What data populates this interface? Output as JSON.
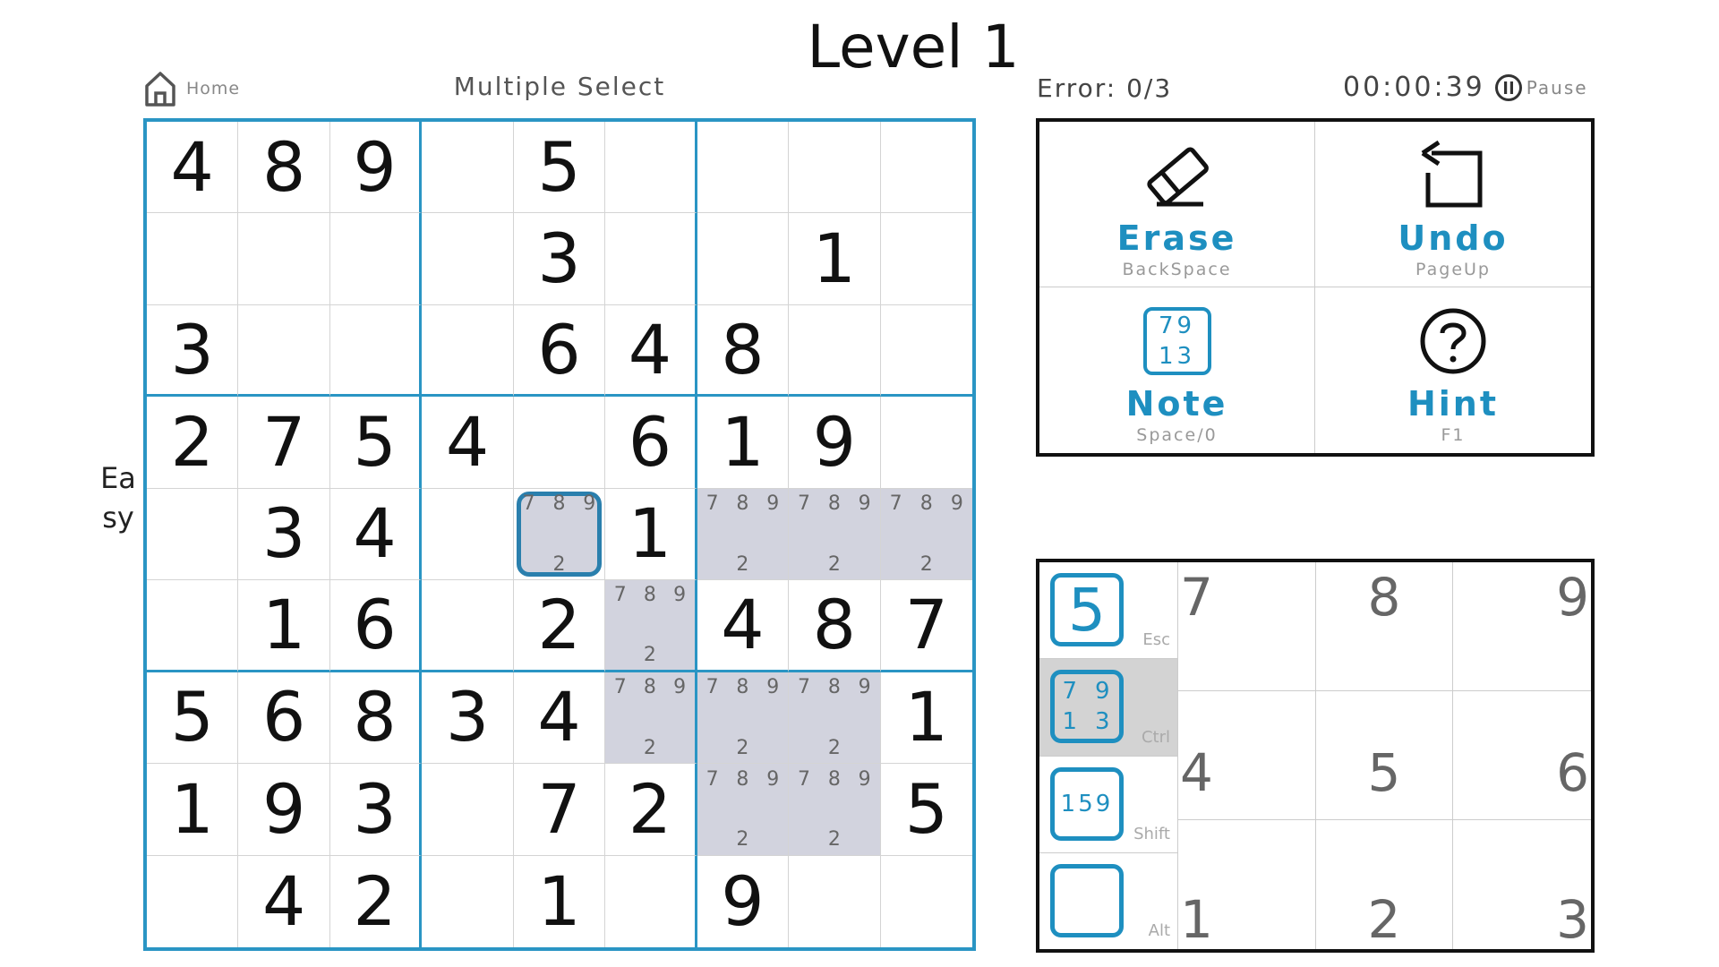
{
  "header": {
    "title": "Level 1",
    "home_label": "Home",
    "mode_label": "Multiple Select",
    "difficulty": "Easy",
    "errors": "Error: 0/3",
    "timer": "00:00:39",
    "pause_label": "Pause"
  },
  "board": {
    "cells": [
      [
        "4",
        "8",
        "9",
        "",
        "5",
        "",
        "",
        "",
        ""
      ],
      [
        "",
        "",
        "",
        "",
        "3",
        "",
        "",
        "1",
        ""
      ],
      [
        "3",
        "",
        "",
        "",
        "6",
        "4",
        "8",
        "",
        ""
      ],
      [
        "2",
        "7",
        "5",
        "4",
        "",
        "6",
        "1",
        "9",
        ""
      ],
      [
        "",
        "3",
        "4",
        "",
        "",
        "1",
        "",
        "",
        ""
      ],
      [
        "",
        "1",
        "6",
        "",
        "2",
        "",
        "4",
        "8",
        "7"
      ],
      [
        "5",
        "6",
        "8",
        "3",
        "4",
        "",
        "",
        "",
        "1"
      ],
      [
        "1",
        "9",
        "3",
        "",
        "7",
        "2",
        "",
        "",
        "5"
      ],
      [
        "",
        "4",
        "2",
        "",
        "1",
        "",
        "9",
        "",
        ""
      ]
    ],
    "highlighted": [
      [
        4,
        4
      ],
      [
        4,
        6
      ],
      [
        4,
        7
      ],
      [
        4,
        8
      ],
      [
        5,
        5
      ],
      [
        6,
        5
      ],
      [
        6,
        6
      ],
      [
        6,
        7
      ],
      [
        7,
        6
      ],
      [
        7,
        7
      ]
    ],
    "cursor": [
      4,
      4
    ],
    "notes": [
      "7",
      "8",
      "9",
      "2"
    ]
  },
  "tools": [
    {
      "name": "Erase",
      "key": "BackSpace",
      "icon": "eraser-icon"
    },
    {
      "name": "Undo",
      "key": "PageUp",
      "icon": "undo-icon"
    },
    {
      "name": "Note",
      "key": "Space/0",
      "icon": "note-icon",
      "icon_lines": [
        "79",
        "13"
      ]
    },
    {
      "name": "Hint",
      "key": "F1",
      "icon": "hint-icon"
    }
  ],
  "input_modes": [
    {
      "name": "normal",
      "icon_text": "5",
      "key": "Esc"
    },
    {
      "name": "corner",
      "icon_lines": [
        "79",
        "13"
      ],
      "key": "Ctrl",
      "active": true
    },
    {
      "name": "center",
      "icon_text": "159",
      "key": "Shift"
    },
    {
      "name": "color",
      "key": "Alt",
      "colors": [
        "#c8174e",
        "#2d13c8",
        "#16b22c",
        "#c8c116"
      ]
    }
  ],
  "digits": [
    "7",
    "8",
    "9",
    "4",
    "5",
    "6",
    "1",
    "2",
    "3"
  ],
  "colors": {
    "accent": "#1e8fc0",
    "grid": "#2a95c4",
    "highlight": "#d2d3de"
  }
}
